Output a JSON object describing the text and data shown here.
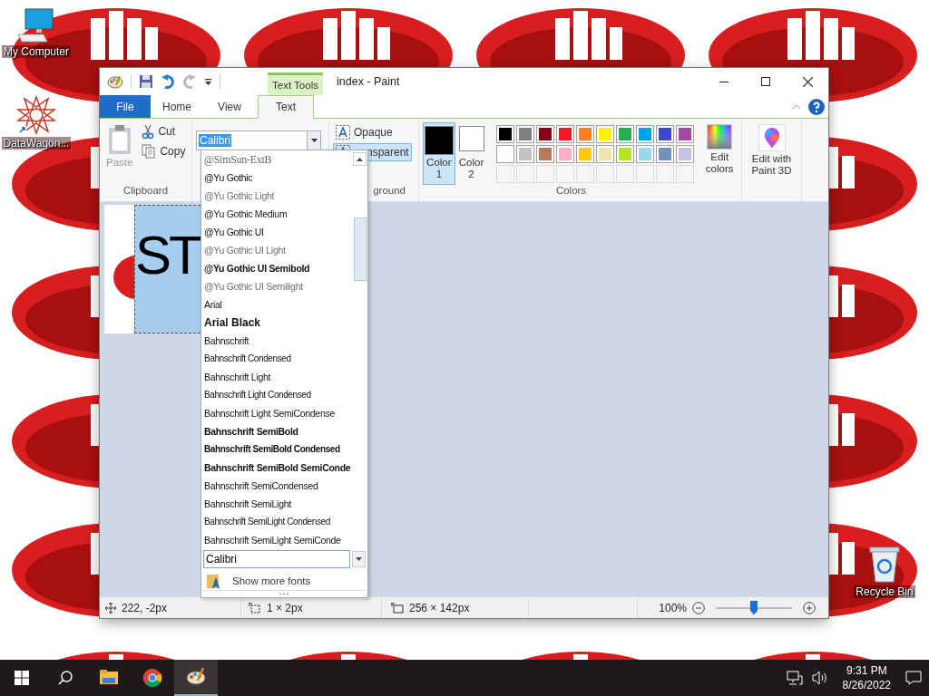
{
  "desktop_icons": [
    {
      "kind": "computer",
      "label": "My Computer"
    },
    {
      "kind": "shortcut",
      "label": "DataWagon..."
    },
    {
      "kind": "recycle",
      "label": "Recycle Bin"
    }
  ],
  "window": {
    "title": "index - Paint",
    "context_tab": "Text Tools"
  },
  "ribbon_tabs": [
    {
      "label": "File",
      "kind": "file",
      "selected": false
    },
    {
      "label": "Home",
      "kind": "tab",
      "selected": false
    },
    {
      "label": "View",
      "kind": "tab",
      "selected": false
    },
    {
      "label": "Text",
      "kind": "tab",
      "selected": true
    }
  ],
  "clipboard": {
    "group_label": "Clipboard",
    "paste": {
      "label": "Paste",
      "disabled": true
    },
    "cut": "Cut",
    "copy": "Copy"
  },
  "font": {
    "value": "Calibri"
  },
  "background": {
    "group_label": "ground",
    "options": [
      {
        "label": "Opaque",
        "selected": false
      },
      {
        "label": "nsparent",
        "selected": true
      }
    ]
  },
  "colors": {
    "group_label": "Colors",
    "current": [
      {
        "label": "Color 1",
        "color": "#000000",
        "selected": true
      },
      {
        "label": "Color 2",
        "color": "#ffffff",
        "selected": false
      }
    ],
    "palette": [
      {
        "color": "#000000"
      },
      {
        "color": "#7f7f7f"
      },
      {
        "color": "#880015"
      },
      {
        "color": "#ed1c24"
      },
      {
        "color": "#ff7f27"
      },
      {
        "color": "#fff200"
      },
      {
        "color": "#22b14c"
      },
      {
        "color": "#00a2e8"
      },
      {
        "color": "#3f48cc"
      },
      {
        "color": "#a349a4"
      },
      {
        "color": "#ffffff"
      },
      {
        "color": "#c3c3c3"
      },
      {
        "color": "#b97a57"
      },
      {
        "color": "#ffaec9"
      },
      {
        "color": "#ffc90e"
      },
      {
        "color": "#efe4b0"
      },
      {
        "color": "#b5e61d"
      },
      {
        "color": "#99d9ea"
      },
      {
        "color": "#7092be"
      },
      {
        "color": "#c8bfe7"
      }
    ],
    "edit_colors": "Edit colors"
  },
  "paint3d": "Edit with Paint 3D",
  "canvas": {
    "text": "ST"
  },
  "font_list": {
    "items": [
      {
        "label": "@SimSun-ExtB",
        "kind": "serif"
      },
      {
        "label": "@Yu Gothic",
        "kind": "regular"
      },
      {
        "label": "@Yu Gothic Light",
        "kind": "light"
      },
      {
        "label": "@Yu Gothic Medium",
        "kind": "medium"
      },
      {
        "label": "@Yu Gothic UI",
        "kind": "regular"
      },
      {
        "label": "@Yu Gothic UI Light",
        "kind": "light"
      },
      {
        "label": "@Yu Gothic UI Semibold",
        "kind": "semibold"
      },
      {
        "label": "@Yu Gothic UI Semilight",
        "kind": "light"
      },
      {
        "label": "Arial",
        "kind": "regular"
      },
      {
        "label": "Arial Black",
        "kind": "black"
      },
      {
        "label": "Bahnschrift",
        "kind": "regular"
      },
      {
        "label": "Bahnschrift Condensed",
        "kind": "condensed"
      },
      {
        "label": "Bahnschrift Light",
        "kind": "regular"
      },
      {
        "label": "Bahnschrift Light Condensed",
        "kind": "condensed"
      },
      {
        "label": "Bahnschrift Light SemiCondense",
        "kind": "regular"
      },
      {
        "label": "Bahnschrift SemiBold",
        "kind": "semibold"
      },
      {
        "label": "Bahnschrift SemiBold Condensed",
        "kind": "condensed-bold"
      },
      {
        "label": "Bahnschrift SemiBold SemiConde",
        "kind": "semibold"
      },
      {
        "label": "Bahnschrift SemiCondensed",
        "kind": "regular"
      },
      {
        "label": "Bahnschrift SemiLight",
        "kind": "regular"
      },
      {
        "label": "Bahnschrift SemiLight Condensed",
        "kind": "condensed"
      },
      {
        "label": "Bahnschrift SemiLight SemiConde",
        "kind": "regular"
      }
    ],
    "search_value": "Calibri",
    "more": "Show more fonts"
  },
  "status_bar": {
    "cursor": "222, -2px",
    "selection": "1 × 2px",
    "size": "256 × 142px",
    "zoom": "100%",
    "zoom_slider": {
      "level": 0.5
    }
  },
  "taskbar": {
    "apps": [
      {
        "kind": "files",
        "selected": false
      },
      {
        "kind": "browser",
        "selected": false
      },
      {
        "kind": "paint",
        "selected": true
      }
    ],
    "time": "9:31 PM",
    "date": "8/26/2022"
  }
}
